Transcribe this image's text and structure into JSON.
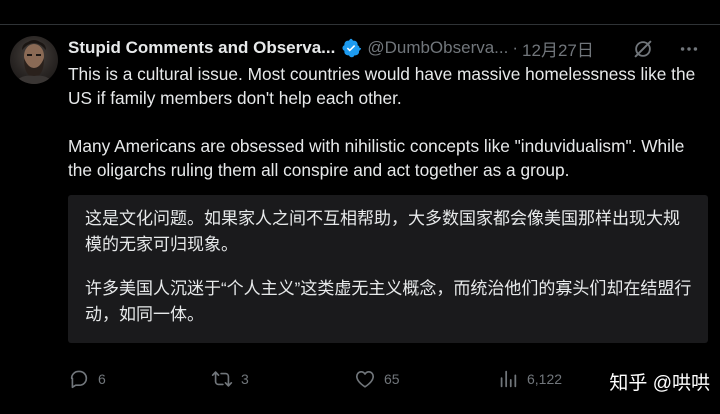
{
  "tweet": {
    "display_name": "Stupid Comments and Observa...",
    "handle": "@DumbObserva...",
    "separator": "·",
    "date": "12月27日",
    "paragraphs": [
      "This is a cultural issue. Most countries would have massive homelessness like the US if family members don't help each other.",
      "Many Americans are obsessed with nihilistic concepts like \"induvidualism\". While the oligarchs ruling them all conspire and act together as a group."
    ],
    "translation": [
      "这是文化问题。如果家人之间不互相帮助，大多数国家都会像美国那样出现大规模的无家可归现象。",
      "许多美国人沉迷于“个人主义”这类虚无主义概念，而统治他们的寡头们却在结盟行动，如同一体。"
    ]
  },
  "actions": {
    "replies": "6",
    "reposts": "3",
    "likes": "65",
    "views": "6,122"
  },
  "watermark": "知乎 @哄哄",
  "colors": {
    "background": "#000000",
    "text": "#e7e9ea",
    "muted": "#71767b",
    "verified": "#1d9bf0",
    "translation_bg": "#1a1a1c"
  },
  "icons": [
    "verified-badge-icon",
    "grok-icon",
    "more-icon",
    "reply-icon",
    "repost-icon",
    "like-icon",
    "views-icon"
  ]
}
